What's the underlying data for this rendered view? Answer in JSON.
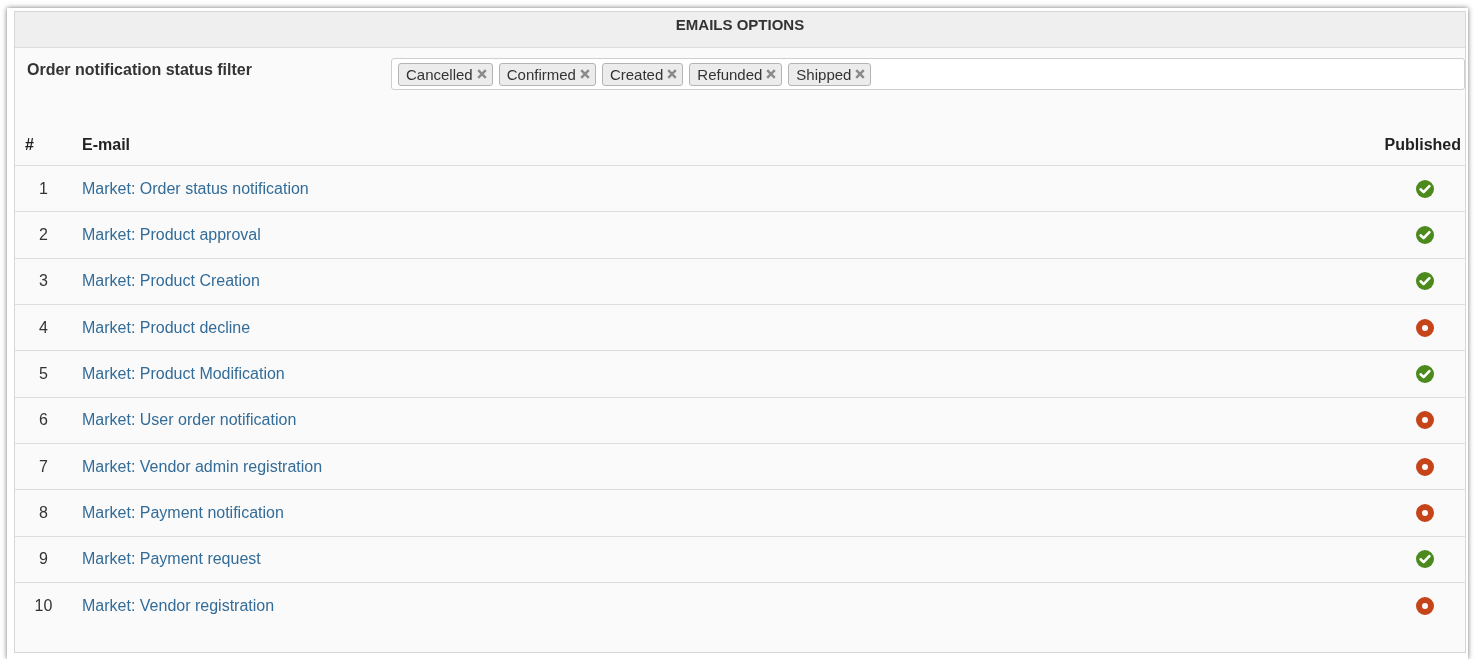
{
  "panel": {
    "title": "EMAILS OPTIONS"
  },
  "filter": {
    "label": "Order notification status filter",
    "tags": [
      "Cancelled",
      "Confirmed",
      "Created",
      "Refunded",
      "Shipped"
    ]
  },
  "table": {
    "columns": [
      "#",
      "E-mail",
      "Published"
    ],
    "rows": [
      {
        "number": "1",
        "email": "Market: Order status notification",
        "published": true
      },
      {
        "number": "2",
        "email": "Market: Product approval",
        "published": true
      },
      {
        "number": "3",
        "email": "Market: Product Creation",
        "published": true
      },
      {
        "number": "4",
        "email": "Market: Product decline",
        "published": false
      },
      {
        "number": "5",
        "email": "Market: Product Modification",
        "published": true
      },
      {
        "number": "6",
        "email": "Market: User order notification",
        "published": false
      },
      {
        "number": "7",
        "email": "Market: Vendor admin registration",
        "published": false
      },
      {
        "number": "8",
        "email": "Market: Payment notification",
        "published": false
      },
      {
        "number": "9",
        "email": "Market: Payment request",
        "published": true
      },
      {
        "number": "10",
        "email": "Market: Vendor registration",
        "published": false
      }
    ]
  }
}
